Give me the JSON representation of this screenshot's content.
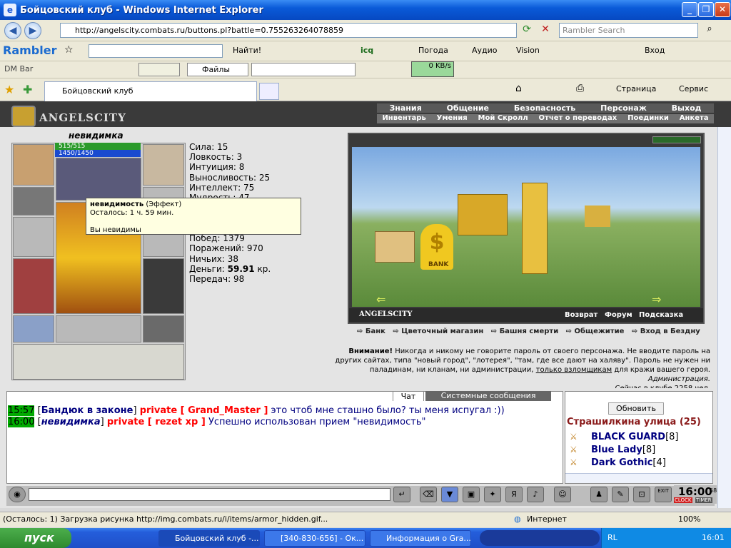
{
  "window": {
    "title": "Бойцовский клуб - Windows Internet Explorer"
  },
  "address": {
    "url": "http://angelscity.combats.ru/buttons.pl?battle=0.755263264078859",
    "search_placeholder": "Rambler Search"
  },
  "rambler_toolbar": {
    "logo": "Rambler",
    "find": "Найти!",
    "icq": "icq",
    "weather": "Погода",
    "audio": "Аудио",
    "vision": "Vision",
    "login": "Вход"
  },
  "dm_toolbar": {
    "label": "DM Bar",
    "files": "Файлы",
    "speed": "0 KB/s"
  },
  "tabs": {
    "active": "Бойцовский клуб",
    "page": "Страница",
    "service": "Сервис"
  },
  "game": {
    "logo": "ANGELSCITY",
    "menu_top": [
      "Знания",
      "Общение",
      "Безопасность",
      "Персонаж",
      "Выход"
    ],
    "menu_bottom": [
      "Инвентарь",
      "Умения",
      "Мой Скролл",
      "Отчет о переводах",
      "Поединки",
      "Анкета"
    ],
    "character": {
      "name": "невидимка",
      "hp": "515/515",
      "mp": "1450/1450"
    },
    "stats": [
      {
        "label": "Сила:",
        "value": "15"
      },
      {
        "label": "Ловкость:",
        "value": "3"
      },
      {
        "label": "Интуиция:",
        "value": "8"
      },
      {
        "label": "Выносливость:",
        "value": "25"
      },
      {
        "label": "Интеллект:",
        "value": "75"
      },
      {
        "label": "Мудрость:",
        "value": "47"
      }
    ],
    "stats2": [
      {
        "label": "Побед:",
        "value": "1379"
      },
      {
        "label": "Поражений:",
        "value": "970"
      },
      {
        "label": "Ничьих:",
        "value": "38"
      },
      {
        "label": "Деньги:",
        "value": "59.91",
        "suffix": "кр."
      },
      {
        "label": "Передач:",
        "value": "98"
      }
    ],
    "tooltip": {
      "title": "невидимость",
      "type": "(Эффект)",
      "remaining": "Осталось: 1 ч. 59 мин.",
      "desc": "Вы невидимы"
    },
    "scene": {
      "caption": "ANGELSCITY",
      "links": [
        "Возврат",
        "Форум",
        "Подсказка"
      ],
      "bank_label": "BANK"
    },
    "places": [
      "Банк",
      "Цветочный магазин",
      "Башня смерти",
      "Общежитие",
      "Вход в Бездну"
    ],
    "warning": {
      "lead": "Внимание!",
      "text1": "Никогда и никому не говорите пароль от своего персонажа. Не вводите пароль на",
      "text2": "других сайтах, типа \"новый город\", \"лотерея\", \"там, где все дают на халяву\". Пароль не нужен ни",
      "text3": "паладинам, ни кланам, ни администрации,",
      "link": "только взломщикам",
      "text4": "для кражи вашего героя.",
      "sign": "Администрация.",
      "online": "Сейчас в клубе 2258 чел."
    }
  },
  "chat": {
    "tab_chat": "Чат",
    "tab_system": "Системные сообщения",
    "lines": [
      {
        "time": "15:57",
        "from": "Бандюк в законе",
        "private": "private [ Grand_Master ]",
        "text": "это чтоб мне сташно было? ты меня испугал :))"
      },
      {
        "time": "16:00",
        "from": "невидимка",
        "private": "private [ rezet xp ]",
        "text": "Успешно использован прием \"невидимость\""
      }
    ]
  },
  "online": {
    "refresh": "Обновить",
    "location": "Страшилкина улица (25)",
    "users": [
      {
        "name": "BLACK GUARD",
        "level": "[8]"
      },
      {
        "name": "Blue Lady",
        "level": "[8]"
      },
      {
        "name": "Dark Gothic",
        "level": "[4]"
      }
    ]
  },
  "clock": {
    "time": "16:00",
    "sec": "58",
    "clock_label": "CLOCK",
    "timer_label": "TIMER",
    "exit": "EXIT"
  },
  "status": {
    "text": "(Осталось: 1) Загрузка рисунка http://img.combats.ru/i/items/armor_hidden.gif...",
    "zone": "Интернет",
    "zoom": "100%"
  },
  "taskbar": {
    "start": "пуск",
    "tasks": [
      "Бойцовский клуб -...",
      "[340-830-656] - Ок...",
      "Информация о Gra..."
    ],
    "lang": "RL",
    "time": "16:01"
  },
  "colors": {
    "accent": "#0a5ad8",
    "private": "#ff0000",
    "user": "#000080",
    "time_bg": "#00aa00"
  }
}
